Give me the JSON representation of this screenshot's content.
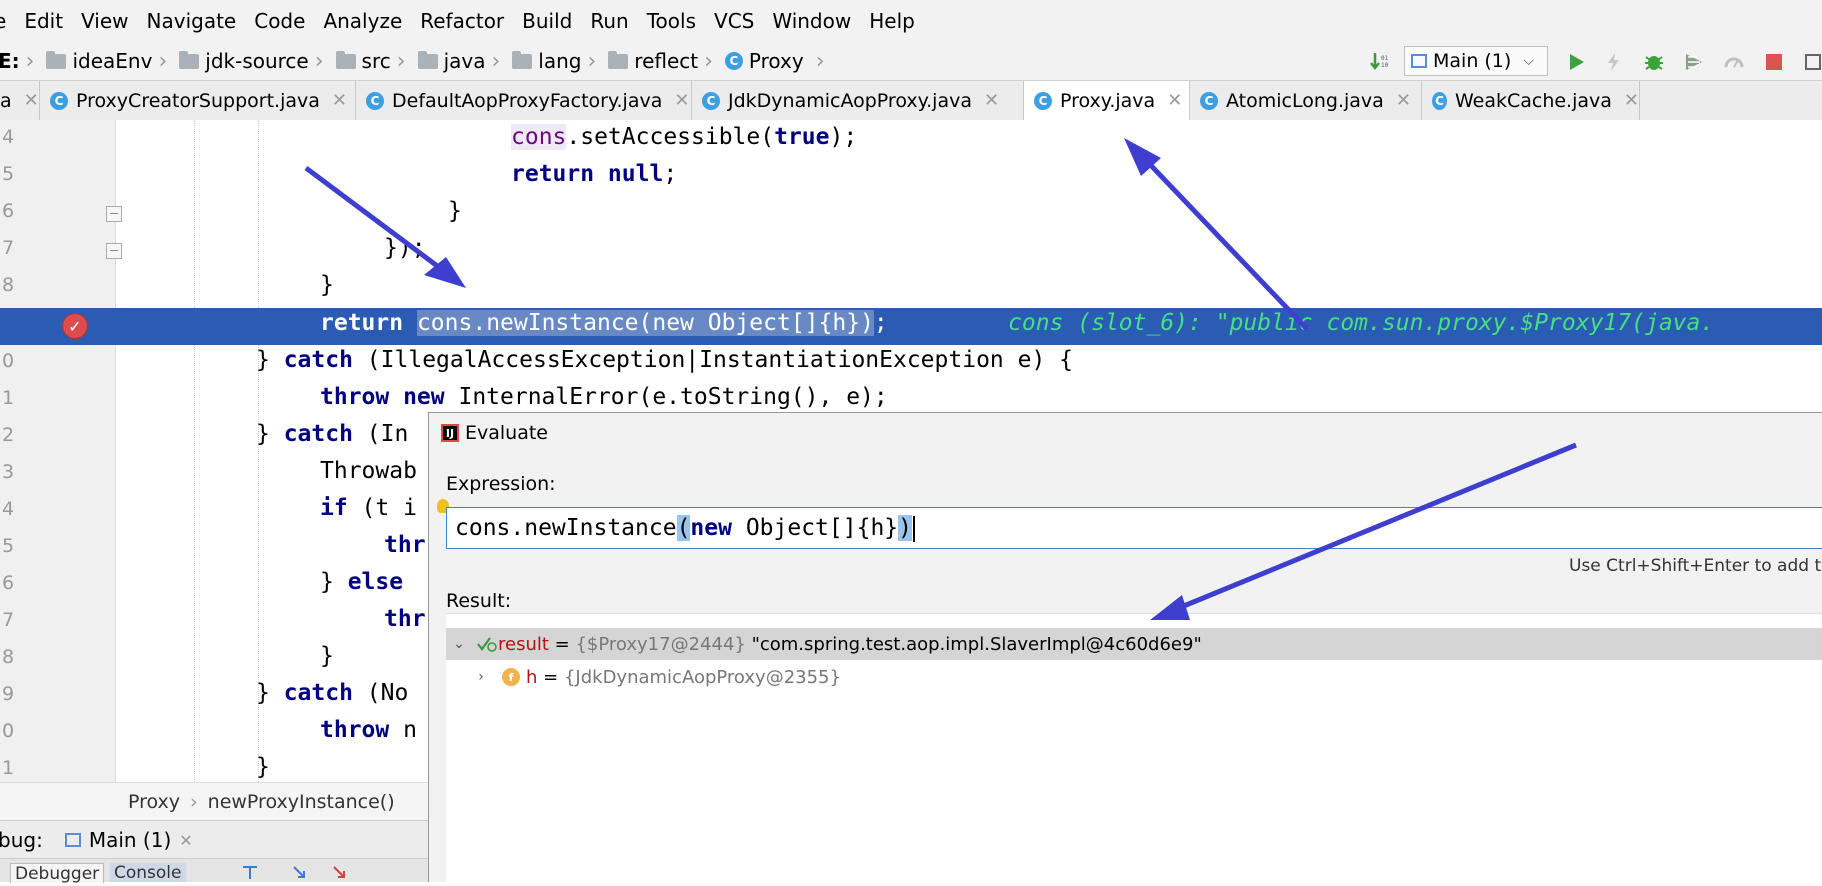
{
  "menu": [
    "e",
    "Edit",
    "View",
    "Navigate",
    "Code",
    "Analyze",
    "Refactor",
    "Build",
    "Run",
    "Tools",
    "VCS",
    "Window",
    "Help"
  ],
  "breadcrumb": {
    "drive": "E:",
    "items": [
      "ideaEnv",
      "jdk-source",
      "src",
      "java",
      "lang",
      "reflect",
      "Proxy"
    ]
  },
  "run_config": "Main (1)",
  "toolbar_icons": [
    "step-over-icon",
    "run-icon",
    "lightning-icon",
    "debug-icon",
    "coverage-icon",
    "profile-icon",
    "stop-icon"
  ],
  "tabs": [
    {
      "label": "ProxyCreatorSupport.java"
    },
    {
      "label": "DefaultAopProxyFactory.java"
    },
    {
      "label": "JdkDynamicAopProxy.java"
    },
    {
      "label": "Proxy.java"
    },
    {
      "label": "AtomicLong.java"
    },
    {
      "label": "WeakCache.java"
    }
  ],
  "line_numbers": [
    "4",
    "5",
    "6",
    "7",
    "8",
    "9",
    "0",
    "1",
    "2",
    "3",
    "4",
    "5",
    "6",
    "7",
    "8",
    "9",
    "0",
    "1"
  ],
  "code": {
    "l1": "cons.setAccessible(true);",
    "l2": "return null;",
    "l3": "}",
    "l4": "});",
    "l5": "}",
    "l6_return": "return",
    "l6_expr": "cons.newInstance(new Object[]{h})",
    "l6_semi": ";",
    "l6_inline": "cons (slot_6): \"public com.sun.proxy.$Proxy17(java.",
    "l7": "} catch (IllegalAccessException|InstantiationException e) {",
    "l8": "throw new InternalError(e.toString(), e);",
    "l9": "} catch (In",
    "l10": "Throwab",
    "l11": "if (t i",
    "l12": "thr",
    "l13": "} else",
    "l14": "thr",
    "l15": "}",
    "l16": "} catch (No",
    "l17": "throw n",
    "l18": "}"
  },
  "bottom_breadcrumb": [
    "Proxy",
    "newProxyInstance()"
  ],
  "debug": {
    "label": "bug:",
    "session": "Main (1)",
    "tab1": "Debugger",
    "tab2": "Console"
  },
  "evaluate": {
    "title": "Evaluate",
    "expression_label": "Expression:",
    "expression": "cons.newInstance(new Object[]{h})",
    "hint": "Use Ctrl+Shift+Enter to add to",
    "result_label": "Result:",
    "result": {
      "name": "result",
      "eq": " = ",
      "ref": "{$Proxy17@2444}",
      "value": " \"com.spring.test.aop.impl.SlaverImpl@4c60d6e9\""
    },
    "child": {
      "name": "h",
      "eq": " = ",
      "ref": "{JdkDynamicAopProxy@2355}"
    }
  },
  "colors": {
    "execution_line": "#2a5cb3",
    "annotation_arrow": "#3f3fcf",
    "inline_debug_value": "#46e084",
    "keyword": "#000080"
  }
}
